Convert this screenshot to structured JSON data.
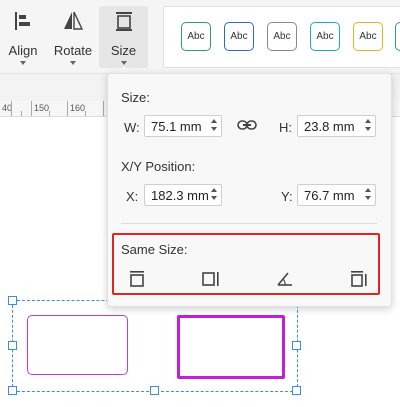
{
  "toolbar": {
    "align_label": "Align",
    "rotate_label": "Rotate",
    "size_label": "Size",
    "icons": {
      "align": "align-icon",
      "rotate": "rotate-icon",
      "size": "size-icon"
    },
    "style_chips": [
      {
        "label": "Abc",
        "color": "#2e9e6b"
      },
      {
        "label": "Abc",
        "color": "#2c6fb0"
      },
      {
        "label": "Abc",
        "color": "#8a8a8a"
      },
      {
        "label": "Abc",
        "color": "#1fa7c9"
      },
      {
        "label": "Abc",
        "color": "#e0b325"
      }
    ]
  },
  "ruler": {
    "labels": [
      "40",
      "150",
      "160"
    ]
  },
  "popup": {
    "size_title": "Size:",
    "w_label": "W:",
    "w_value": "75.1 mm",
    "h_label": "H:",
    "h_value": "23.8 mm",
    "position_title": "X/Y Position:",
    "x_label": "X:",
    "x_value": "182.3 mm",
    "y_label": "Y:",
    "y_value": "76.7 mm",
    "same_size_title": "Same Size:",
    "same_size_icons": [
      "same-height-icon",
      "same-width-icon",
      "same-angle-icon",
      "same-size-icon"
    ],
    "highlight_color": "#e02525"
  },
  "canvas": {
    "selection_color": "#3d8ed6",
    "shape_color": "#c31fd6"
  }
}
